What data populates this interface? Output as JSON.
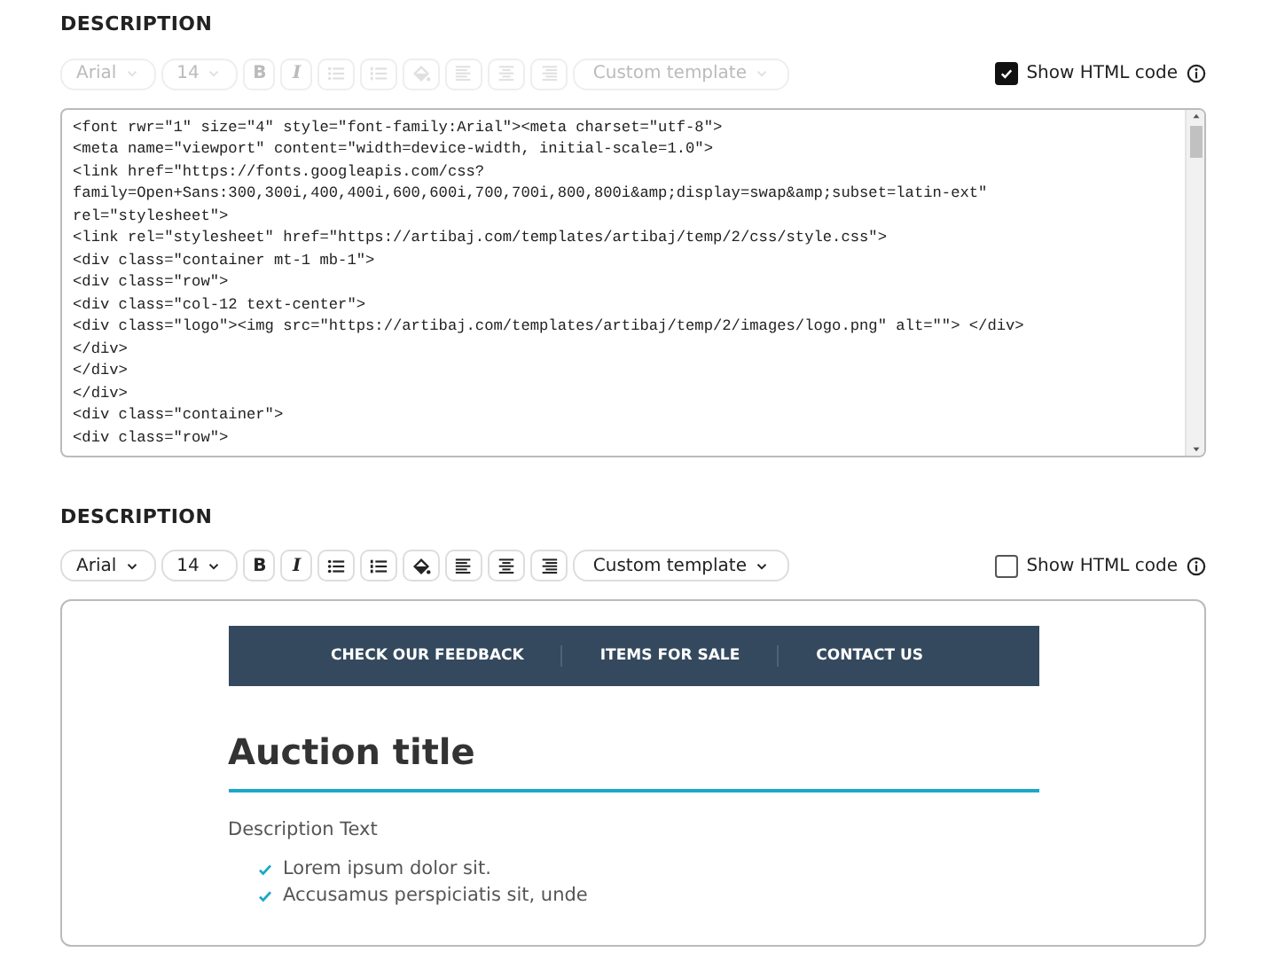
{
  "editors": [
    {
      "kind": "code",
      "heading": "DESCRIPTION",
      "toolbar": {
        "disabled": true,
        "font": "Arial",
        "size": "14",
        "bold": "B",
        "italic": "I",
        "template": "Custom template"
      },
      "show_html": {
        "label": "Show HTML code",
        "checked": true
      },
      "code_lines": [
        "<font rwr=\"1\" size=\"4\" style=\"font-family:Arial\"><meta charset=\"utf-8\">",
        "<meta name=\"viewport\" content=\"width=device-width, initial-scale=1.0\">",
        "<link href=\"https://fonts.googleapis.com/css?",
        "family=Open+Sans:300,300i,400,400i,600,600i,700,700i,800,800i&amp;display=swap&amp;subset=latin-ext\"",
        "rel=\"stylesheet\">",
        "<link rel=\"stylesheet\" href=\"https://artibaj.com/templates/artibaj/temp/2/css/style.css\">",
        "<div class=\"container mt-1 mb-1\">",
        "<div class=\"row\">",
        "<div class=\"col-12 text-center\">",
        "<div class=\"logo\"><img src=\"https://artibaj.com/templates/artibaj/temp/2/images/logo.png\" alt=\"\"> </div>",
        "</div>",
        "</div>",
        "</div>",
        "<div class=\"container\">",
        "<div class=\"row\">"
      ]
    },
    {
      "kind": "preview",
      "heading": "DESCRIPTION",
      "toolbar": {
        "disabled": false,
        "font": "Arial",
        "size": "14",
        "bold": "B",
        "italic": "I",
        "template": "Custom template"
      },
      "show_html": {
        "label": "Show HTML code",
        "checked": false
      },
      "preview": {
        "nav": [
          "CHECK OUR FEEDBACK",
          "ITEMS FOR SALE",
          "CONTACT US"
        ],
        "title": "Auction title",
        "description": "Description Text",
        "items": [
          "Lorem ipsum dolor sit.",
          "Accusamus perspiciatis sit, unde"
        ]
      }
    }
  ]
}
